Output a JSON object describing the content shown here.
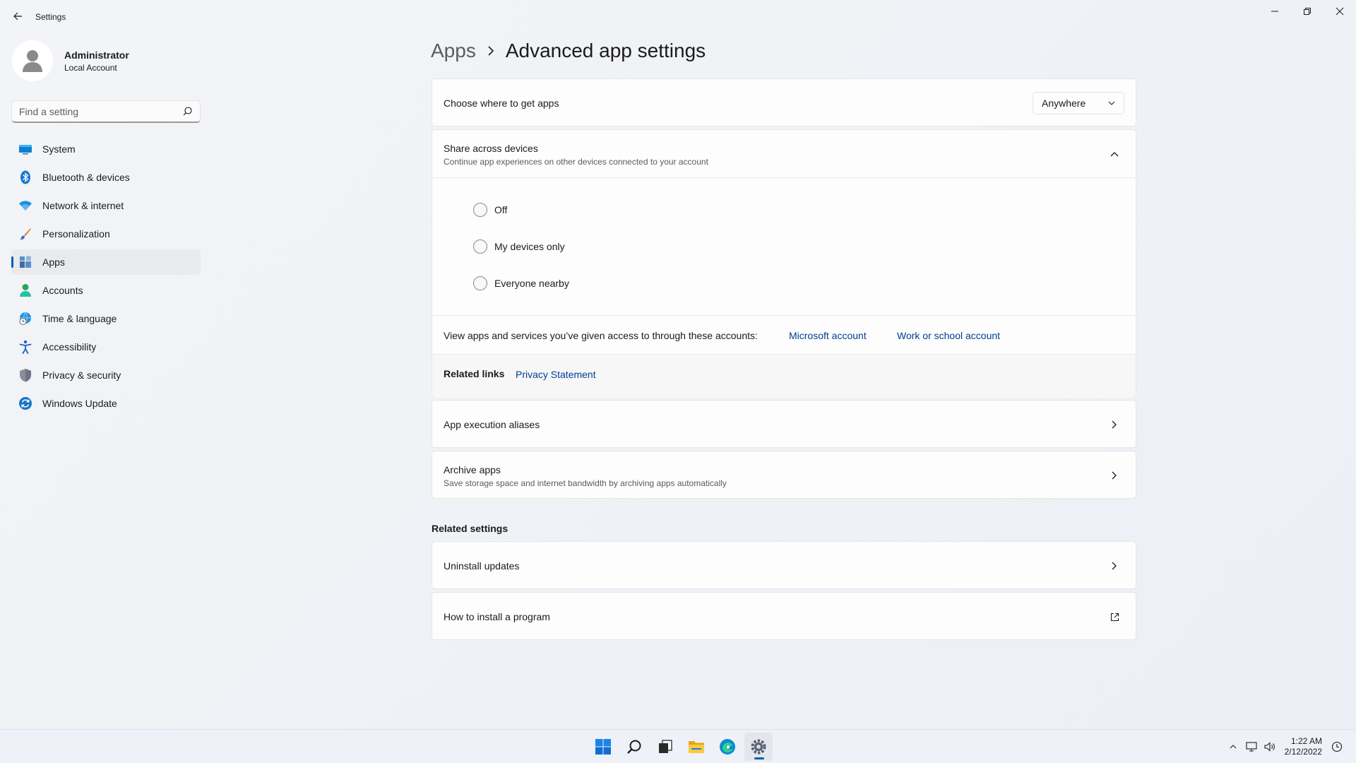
{
  "window": {
    "title": "Settings",
    "controls": [
      "minimize",
      "restore",
      "close"
    ]
  },
  "profile": {
    "name": "Administrator",
    "account_type": "Local Account"
  },
  "search": {
    "placeholder": "Find a setting"
  },
  "sidebar": {
    "items": [
      {
        "label": "System",
        "icon": "monitor-icon",
        "active": false
      },
      {
        "label": "Bluetooth & devices",
        "icon": "bluetooth-icon",
        "active": false
      },
      {
        "label": "Network & internet",
        "icon": "wifi-icon",
        "active": false
      },
      {
        "label": "Personalization",
        "icon": "brush-icon",
        "active": false
      },
      {
        "label": "Apps",
        "icon": "apps-icon",
        "active": true
      },
      {
        "label": "Accounts",
        "icon": "person-icon",
        "active": false
      },
      {
        "label": "Time & language",
        "icon": "globe-clock-icon",
        "active": false
      },
      {
        "label": "Accessibility",
        "icon": "accessibility-icon",
        "active": false
      },
      {
        "label": "Privacy & security",
        "icon": "shield-icon",
        "active": false
      },
      {
        "label": "Windows Update",
        "icon": "update-icon",
        "active": false
      }
    ]
  },
  "breadcrumb": {
    "parent": "Apps",
    "current": "Advanced app settings"
  },
  "main": {
    "get_apps": {
      "label": "Choose where to get apps",
      "selected": "Anywhere"
    },
    "share": {
      "title": "Share across devices",
      "subtitle": "Continue app experiences on other devices connected to your account",
      "options": [
        "Off",
        "My devices only",
        "Everyone nearby"
      ],
      "accounts_text": "View apps and services you’ve given access to through these accounts:",
      "accounts_links": [
        "Microsoft account",
        "Work or school account"
      ],
      "related_links_label": "Related links",
      "privacy_link": "Privacy Statement"
    },
    "aliases": {
      "title": "App execution aliases"
    },
    "archive": {
      "title": "Archive apps",
      "subtitle": "Save storage space and internet bandwidth by archiving apps automatically"
    },
    "related_settings": {
      "heading": "Related settings",
      "uninstall": "Uninstall updates",
      "install": "How to install a program"
    }
  },
  "taskbar": {
    "apps": [
      "start-icon",
      "search-icon",
      "task-view-icon",
      "file-explorer-icon",
      "edge-icon",
      "settings-icon"
    ],
    "active_app": "settings-icon",
    "time": "1:22 AM",
    "date": "2/12/2022"
  },
  "colors": {
    "accent": "#005fb8",
    "link": "#003e92",
    "background": "#f3f4f7"
  }
}
